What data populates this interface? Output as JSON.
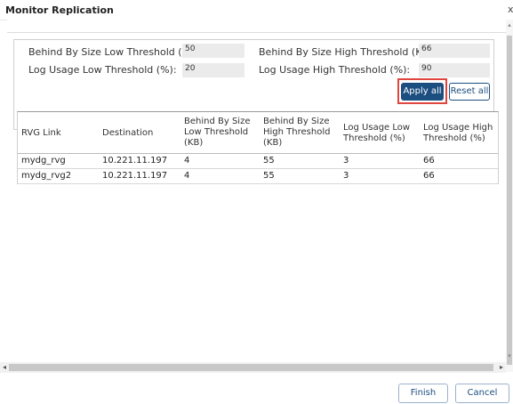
{
  "window": {
    "title": "Monitor Replication",
    "close_glyph": "x"
  },
  "thresholds": {
    "behind_low_label": "Behind By Size Low Threshold (KB):",
    "behind_low_value": "50",
    "behind_high_label": "Behind By Size High Threshold (KB):",
    "behind_high_value": "66",
    "log_low_label": "Log Usage Low Threshold (%):",
    "log_low_value": "20",
    "log_high_label": "Log Usage High Threshold (%):",
    "log_high_value": "90",
    "apply_label": "Apply all",
    "reset_label": "Reset all"
  },
  "table": {
    "headers": [
      "RVG Link",
      "Destination",
      "Behind By Size\nLow Threshold\n(KB)",
      "Behind By Size\nHigh Threshold\n(KB)",
      "Log Usage Low\nThreshold (%)",
      "Log Usage High\nThreshold (%)"
    ],
    "rows": [
      [
        "mydg_rvg",
        "10.221.11.197",
        "4",
        "55",
        "3",
        "66"
      ],
      [
        "mydg_rvg2",
        "10.221.11.197",
        "4",
        "55",
        "3",
        "66"
      ]
    ]
  },
  "footer": {
    "finish_label": "Finish",
    "cancel_label": "Cancel"
  },
  "icons": {
    "scroll_left": "◂",
    "scroll_right": "▸",
    "scroll_up": "▴",
    "scroll_down": "▾"
  },
  "colors": {
    "primary": "#1c4e80",
    "highlight": "#e0453e"
  }
}
